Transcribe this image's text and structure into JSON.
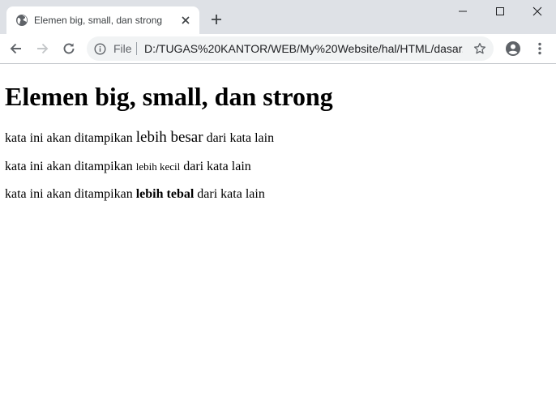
{
  "browser": {
    "tab": {
      "title": "Elemen big, small, dan strong",
      "favicon": "globe-icon"
    },
    "omnibox": {
      "scheme_label": "File",
      "url": "D:/TUGAS%20KANTOR/WEB/My%20Website/hal/HTML/dasar..."
    }
  },
  "page": {
    "heading": "Elemen big, small, dan strong",
    "lines": [
      {
        "before": "kata ini akan ditampikan ",
        "styled": "lebih besar",
        "after": " dari kata lain"
      },
      {
        "before": "kata ini akan ditampikan ",
        "styled": "lebih kecil",
        "after": " dari kata lain"
      },
      {
        "before": "kata ini akan ditampikan ",
        "styled": "lebih tebal",
        "after": " dari kata lain"
      }
    ]
  },
  "colors": {
    "titlebar_bg": "#dee1e6",
    "omnibox_bg": "#f1f3f4",
    "icon": "#5f6368"
  }
}
